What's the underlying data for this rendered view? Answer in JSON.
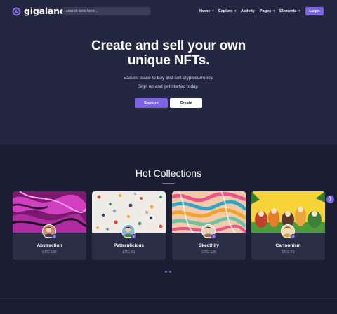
{
  "brand": {
    "name": "gigaland",
    "icon": "swirl-logo-icon",
    "accent": "#7b63e6"
  },
  "nav": {
    "search_placeholder": "search item here...",
    "items": [
      {
        "label": "Home",
        "has_dropdown": true
      },
      {
        "label": "Explore",
        "has_dropdown": true
      },
      {
        "label": "Activity",
        "has_dropdown": false
      },
      {
        "label": "Pages",
        "has_dropdown": true
      },
      {
        "label": "Elements",
        "has_dropdown": true
      }
    ],
    "login_label": "Login"
  },
  "hero": {
    "title_line1": "Create and sell your own",
    "title_line2": "unique NFTs.",
    "subtitle_line1": "Easiest place to buy and sell cryptocurrency.",
    "subtitle_line2": "Sign up and get started today.",
    "explore_label": "Explore",
    "create_label": "Create"
  },
  "collections": {
    "title": "Hot Collections",
    "items": [
      {
        "name": "Abstraction",
        "erc": "ERC-192"
      },
      {
        "name": "Patternlicious",
        "erc": "ERC-61"
      },
      {
        "name": "Skecthify",
        "erc": "ERC-126"
      },
      {
        "name": "Cartoonism",
        "erc": "ERC-73"
      }
    ],
    "next_icon": "chevron-right-icon",
    "pagination": {
      "pages": 2,
      "active": 1
    }
  }
}
